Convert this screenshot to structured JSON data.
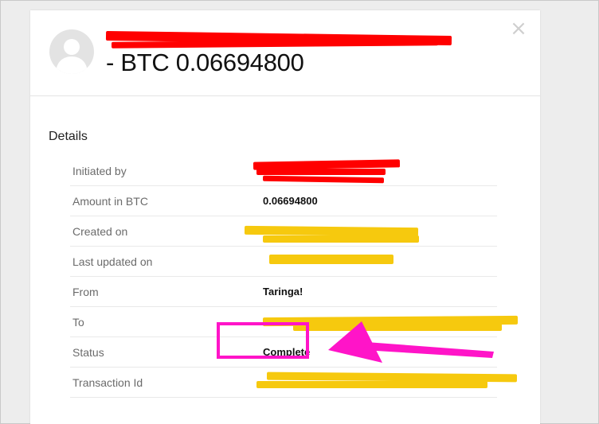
{
  "header": {
    "sender_line": "",
    "title": "- BTC 0.06694800",
    "close_glyph": "×"
  },
  "details": {
    "heading": "Details",
    "rows": [
      {
        "label": "Initiated by",
        "value": ""
      },
      {
        "label": "Amount in BTC",
        "value": "0.06694800"
      },
      {
        "label": "Created on",
        "value": ""
      },
      {
        "label": "Last updated on",
        "value": ""
      },
      {
        "label": "From",
        "value": "Taringa!"
      },
      {
        "label": "To",
        "value": ""
      },
      {
        "label": "Status",
        "value": "Complete"
      },
      {
        "label": "Transaction Id",
        "value": ""
      }
    ]
  },
  "annotation": {
    "box_color": "#ff14c8",
    "redaction_colors": [
      "#ff0000",
      "#f6c90e"
    ]
  }
}
